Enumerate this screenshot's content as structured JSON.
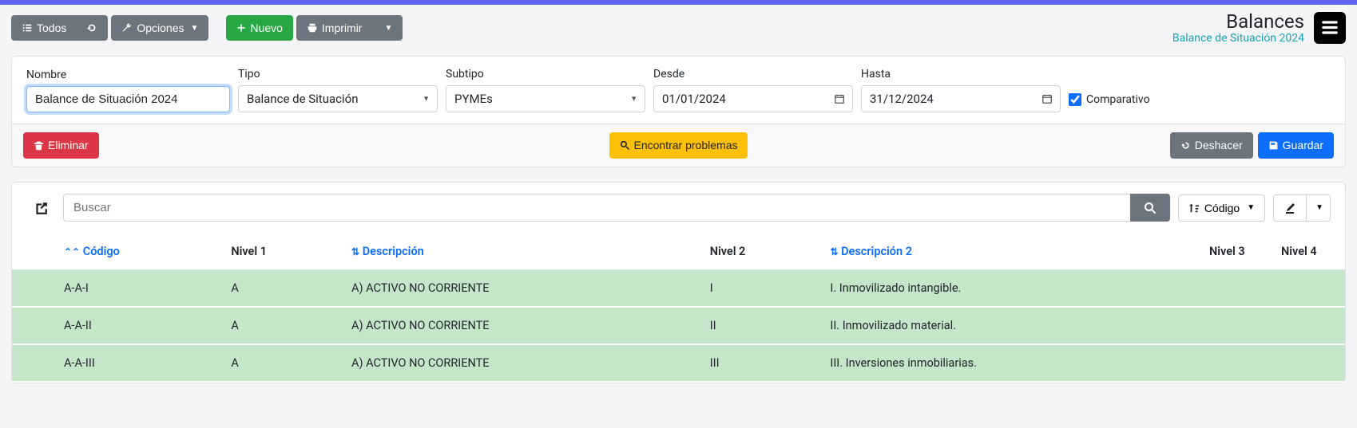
{
  "header": {
    "title": "Balances",
    "subtitle": "Balance de Situación 2024"
  },
  "toolbar": {
    "todos": "Todos",
    "opciones": "Opciones",
    "nuevo": "Nuevo",
    "imprimir": "Imprimir"
  },
  "form": {
    "nombre_label": "Nombre",
    "nombre_value": "Balance de Situación 2024",
    "tipo_label": "Tipo",
    "tipo_value": "Balance de Situación",
    "subtipo_label": "Subtipo",
    "subtipo_value": "PYMEs",
    "desde_label": "Desde",
    "desde_value": "01/01/2024",
    "hasta_label": "Hasta",
    "hasta_value": "31/12/2024",
    "comparativo_label": "Comparativo",
    "comparativo_checked": true
  },
  "actions": {
    "eliminar": "Eliminar",
    "encontrar_problemas": "Encontrar problemas",
    "deshacer": "Deshacer",
    "guardar": "Guardar"
  },
  "table_toolbar": {
    "buscar_placeholder": "Buscar",
    "codigo_sort": "Código"
  },
  "columns": {
    "codigo": "Código",
    "nivel1": "Nivel 1",
    "descripcion": "Descripción",
    "nivel2": "Nivel 2",
    "descripcion2": "Descripción 2",
    "nivel3": "Nivel 3",
    "nivel4": "Nivel 4"
  },
  "rows": [
    {
      "codigo": "A-A-I",
      "nivel1": "A",
      "descripcion": "A) ACTIVO NO CORRIENTE",
      "nivel2": "I",
      "descripcion2": "I. Inmovilizado intangible."
    },
    {
      "codigo": "A-A-II",
      "nivel1": "A",
      "descripcion": "A) ACTIVO NO CORRIENTE",
      "nivel2": "II",
      "descripcion2": "II. Inmovilizado material."
    },
    {
      "codigo": "A-A-III",
      "nivel1": "A",
      "descripcion": "A) ACTIVO NO CORRIENTE",
      "nivel2": "III",
      "descripcion2": "III. Inversiones inmobiliarias."
    }
  ]
}
